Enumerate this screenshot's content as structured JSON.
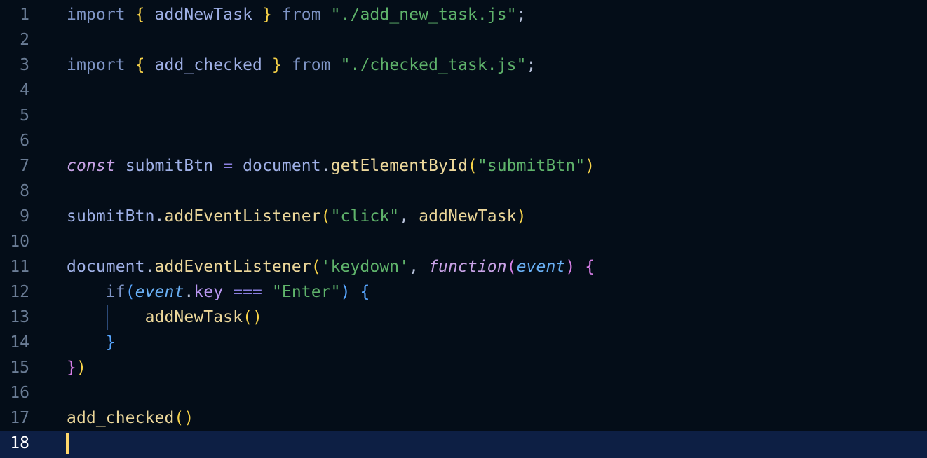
{
  "editor": {
    "active_line": 18,
    "lines": [
      {
        "n": "1",
        "tokens": [
          [
            "import",
            "t-kw"
          ],
          [
            " ",
            ""
          ],
          [
            "{",
            "t-brace1"
          ],
          [
            " ",
            ""
          ],
          [
            "addNewTask",
            "t-ident"
          ],
          [
            " ",
            ""
          ],
          [
            "}",
            "t-brace1"
          ],
          [
            " ",
            ""
          ],
          [
            "from",
            "t-kw"
          ],
          [
            " ",
            ""
          ],
          [
            "\"./add_new_task.js\"",
            "t-str"
          ],
          [
            ";",
            "t-punc"
          ]
        ]
      },
      {
        "n": "2",
        "tokens": []
      },
      {
        "n": "3",
        "tokens": [
          [
            "import",
            "t-kw"
          ],
          [
            " ",
            ""
          ],
          [
            "{",
            "t-brace1"
          ],
          [
            " ",
            ""
          ],
          [
            "add_checked",
            "t-ident"
          ],
          [
            " ",
            ""
          ],
          [
            "}",
            "t-brace1"
          ],
          [
            " ",
            ""
          ],
          [
            "from",
            "t-kw"
          ],
          [
            " ",
            ""
          ],
          [
            "\"./checked_task.js\"",
            "t-str"
          ],
          [
            ";",
            "t-punc"
          ]
        ]
      },
      {
        "n": "4",
        "tokens": []
      },
      {
        "n": "5",
        "tokens": []
      },
      {
        "n": "6",
        "tokens": []
      },
      {
        "n": "7",
        "tokens": [
          [
            "const",
            "t-storage"
          ],
          [
            " ",
            ""
          ],
          [
            "submitBtn",
            "t-ident"
          ],
          [
            " ",
            ""
          ],
          [
            "=",
            "t-op"
          ],
          [
            " ",
            ""
          ],
          [
            "document",
            "t-ident"
          ],
          [
            ".",
            "t-punc"
          ],
          [
            "getElementById",
            "t-fn"
          ],
          [
            "(",
            "t-paren"
          ],
          [
            "\"submitBtn\"",
            "t-str"
          ],
          [
            ")",
            "t-paren"
          ]
        ]
      },
      {
        "n": "8",
        "tokens": []
      },
      {
        "n": "9",
        "tokens": [
          [
            "submitBtn",
            "t-ident"
          ],
          [
            ".",
            "t-punc"
          ],
          [
            "addEventListener",
            "t-fn"
          ],
          [
            "(",
            "t-paren"
          ],
          [
            "\"click\"",
            "t-str"
          ],
          [
            ", ",
            "t-punc"
          ],
          [
            "addNewTask",
            "t-fn"
          ],
          [
            ")",
            "t-paren"
          ]
        ]
      },
      {
        "n": "10",
        "tokens": []
      },
      {
        "n": "11",
        "tokens": [
          [
            "document",
            "t-ident"
          ],
          [
            ".",
            "t-punc"
          ],
          [
            "addEventListener",
            "t-fn"
          ],
          [
            "(",
            "t-paren"
          ],
          [
            "'keydown'",
            "t-str"
          ],
          [
            ", ",
            "t-punc"
          ],
          [
            "function",
            "t-storage"
          ],
          [
            "(",
            "t-paren2"
          ],
          [
            "event",
            "t-param"
          ],
          [
            ")",
            "t-paren2"
          ],
          [
            " ",
            ""
          ],
          [
            "{",
            "t-paren2"
          ]
        ]
      },
      {
        "n": "12",
        "tokens": [
          [
            "    ",
            ""
          ],
          [
            "if",
            "t-if"
          ],
          [
            "(",
            "t-paren3"
          ],
          [
            "event",
            "t-param"
          ],
          [
            ".",
            "t-punc"
          ],
          [
            "key",
            "t-prop"
          ],
          [
            " ",
            ""
          ],
          [
            "===",
            "t-op"
          ],
          [
            " ",
            ""
          ],
          [
            "\"Enter\"",
            "t-str"
          ],
          [
            ")",
            "t-paren3"
          ],
          [
            " ",
            ""
          ],
          [
            "{",
            "t-paren3"
          ]
        ]
      },
      {
        "n": "13",
        "tokens": [
          [
            "        ",
            ""
          ],
          [
            "addNewTask",
            "t-fn"
          ],
          [
            "()",
            "t-paren"
          ]
        ]
      },
      {
        "n": "14",
        "tokens": [
          [
            "    ",
            ""
          ],
          [
            "}",
            "t-paren3"
          ]
        ]
      },
      {
        "n": "15",
        "tokens": [
          [
            "}",
            "t-paren2"
          ],
          [
            ")",
            "t-paren"
          ]
        ]
      },
      {
        "n": "16",
        "tokens": []
      },
      {
        "n": "17",
        "tokens": [
          [
            "add_checked",
            "t-fn"
          ],
          [
            "()",
            "t-paren"
          ]
        ]
      },
      {
        "n": "18",
        "tokens": []
      }
    ]
  }
}
